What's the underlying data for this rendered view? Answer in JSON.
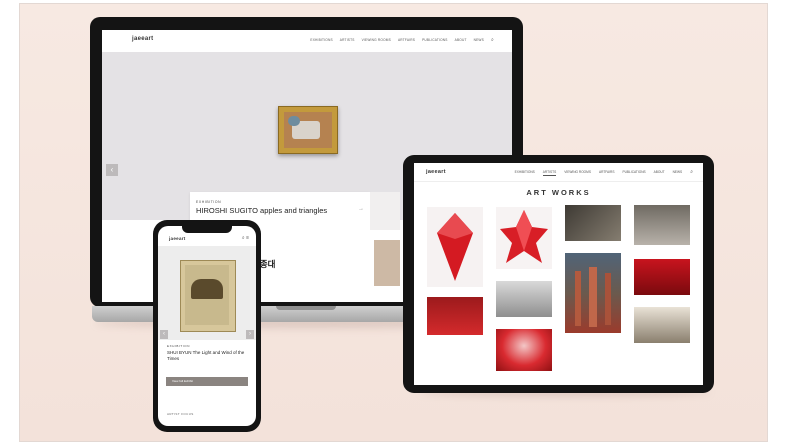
{
  "laptop": {
    "logo": "jaeeart",
    "menu": [
      "EXHIBITIONS",
      "ARTISTS",
      "VIEWING ROOMS",
      "ARTFAIRS",
      "PUBLICATIONS",
      "ABOUT",
      "NEWS"
    ],
    "nav_arrow_left": "‹",
    "nav_arrow_right": "›",
    "card_eyebrow": "EXHIBITION",
    "card_title": "HIROSHI SUGITO apples and triangles",
    "card_arrow": "→",
    "korean_title": "안종대"
  },
  "tablet": {
    "logo": "jaeeart",
    "menu": [
      "EXHIBITIONS",
      "ARTISTS",
      "VIEWING ROOMS",
      "ARTFAIRS",
      "PUBLICATIONS",
      "ABOUT",
      "NEWS"
    ],
    "active_menu": "ARTISTS",
    "heading": "ART WORKS"
  },
  "phone": {
    "logo": "jaeeart",
    "icons": "⌕ ≡",
    "nav_arrow_left": "‹",
    "nav_arrow_right": "›",
    "card_eyebrow": "EXHIBITION",
    "card_title": "SHUI BYUN The Light and Wind of the Times",
    "cta_label": "View full Exhibit",
    "artist_label": "ARTIST FOCUS"
  },
  "colors": {
    "background": "#f5e6df",
    "device": "#141414",
    "accent_red": "#c8141e",
    "cta": "#8a8480"
  }
}
